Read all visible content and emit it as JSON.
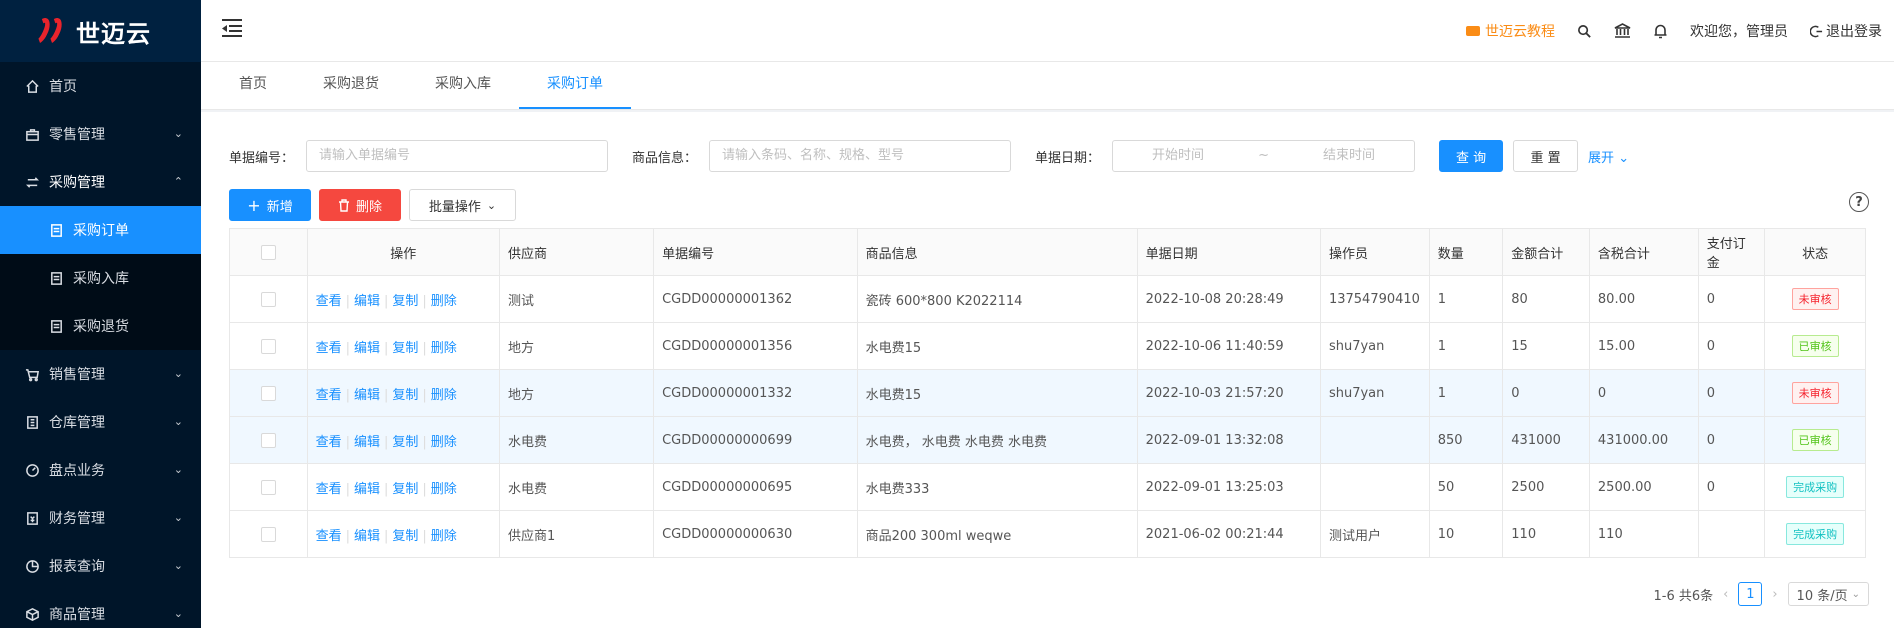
{
  "brand": {
    "name": "世迈云"
  },
  "sidebar": {
    "items": [
      {
        "label": "首页",
        "icon": "home-icon"
      },
      {
        "label": "零售管理",
        "icon": "retail-icon"
      },
      {
        "label": "采购管理",
        "icon": "purchase-icon"
      },
      {
        "label": "采购订单",
        "icon": "doc-icon"
      },
      {
        "label": "采购入库",
        "icon": "doc-icon"
      },
      {
        "label": "采购退货",
        "icon": "doc-icon"
      },
      {
        "label": "销售管理",
        "icon": "cart-icon"
      },
      {
        "label": "仓库管理",
        "icon": "warehouse-icon"
      },
      {
        "label": "盘点业务",
        "icon": "gauge-icon"
      },
      {
        "label": "财务管理",
        "icon": "finance-icon"
      },
      {
        "label": "报表查询",
        "icon": "chart-icon"
      },
      {
        "label": "商品管理",
        "icon": "goods-icon"
      }
    ]
  },
  "header": {
    "tutorial": "世迈云教程",
    "welcome": "欢迎您，管理员",
    "logout": "退出登录"
  },
  "tabs": [
    "首页",
    "采购退货",
    "采购入库",
    "采购订单"
  ],
  "filters": {
    "doc_no_label": "单据编号：",
    "doc_no_placeholder": "请输入单据编号",
    "goods_label": "商品信息：",
    "goods_placeholder": "请输入条码、名称、规格、型号",
    "date_label": "单据日期：",
    "start_placeholder": "开始时间",
    "date_sep": "~",
    "end_placeholder": "结束时间",
    "query": "查 询",
    "reset": "重 置",
    "expand": "展开"
  },
  "toolbar": {
    "add": "新增",
    "delete": "删除",
    "batch": "批量操作"
  },
  "table": {
    "headers": [
      "操作",
      "供应商",
      "单据编号",
      "商品信息",
      "单据日期",
      "操作员",
      "数量",
      "金额合计",
      "含税合计",
      "支付订金",
      "状态"
    ],
    "actions": [
      "查看",
      "编辑",
      "复制",
      "删除"
    ],
    "rows": [
      {
        "supplier": "测试",
        "no": "CGDD00000001362",
        "goods": "瓷砖 600*800 K2022114",
        "date": "2022-10-08 20:28:49",
        "operator": "13754790410",
        "qty": "1",
        "amount": "80",
        "tax_total": "80.00",
        "deposit": "0",
        "status": "未审核",
        "status_type": "red"
      },
      {
        "supplier": "地方",
        "no": "CGDD00000001356",
        "goods": "水电费15",
        "date": "2022-10-06 11:40:59",
        "operator": "shu7yan",
        "qty": "1",
        "amount": "15",
        "tax_total": "15.00",
        "deposit": "0",
        "status": "已审核",
        "status_type": "green"
      },
      {
        "supplier": "地方",
        "no": "CGDD00000001332",
        "goods": "水电费15",
        "date": "2022-10-03 21:57:20",
        "operator": "shu7yan",
        "qty": "1",
        "amount": "0",
        "tax_total": "0",
        "deposit": "0",
        "status": "未审核",
        "status_type": "red"
      },
      {
        "supplier": "水电费",
        "no": "CGDD00000000699",
        "goods": "水电费， 水电费 水电费 水电费",
        "date": "2022-09-01 13:32:08",
        "operator": "",
        "qty": "850",
        "amount": "431000",
        "tax_total": "431000.00",
        "deposit": "0",
        "status": "已审核",
        "status_type": "green"
      },
      {
        "supplier": "水电费",
        "no": "CGDD00000000695",
        "goods": "水电费333",
        "date": "2022-09-01 13:25:03",
        "operator": "",
        "qty": "50",
        "amount": "2500",
        "tax_total": "2500.00",
        "deposit": "0",
        "status": "完成采购",
        "status_type": "cyan"
      },
      {
        "supplier": "供应商1",
        "no": "CGDD00000000630",
        "goods": "商品200 300ml weqwe",
        "date": "2021-06-02 00:21:44",
        "operator": "测试用户",
        "qty": "10",
        "amount": "110",
        "tax_total": "110",
        "deposit": "",
        "status": "完成采购",
        "status_type": "cyan"
      }
    ]
  },
  "pagination": {
    "summary": "1-6 共6条",
    "current": "1",
    "page_size": "10 条/页"
  }
}
